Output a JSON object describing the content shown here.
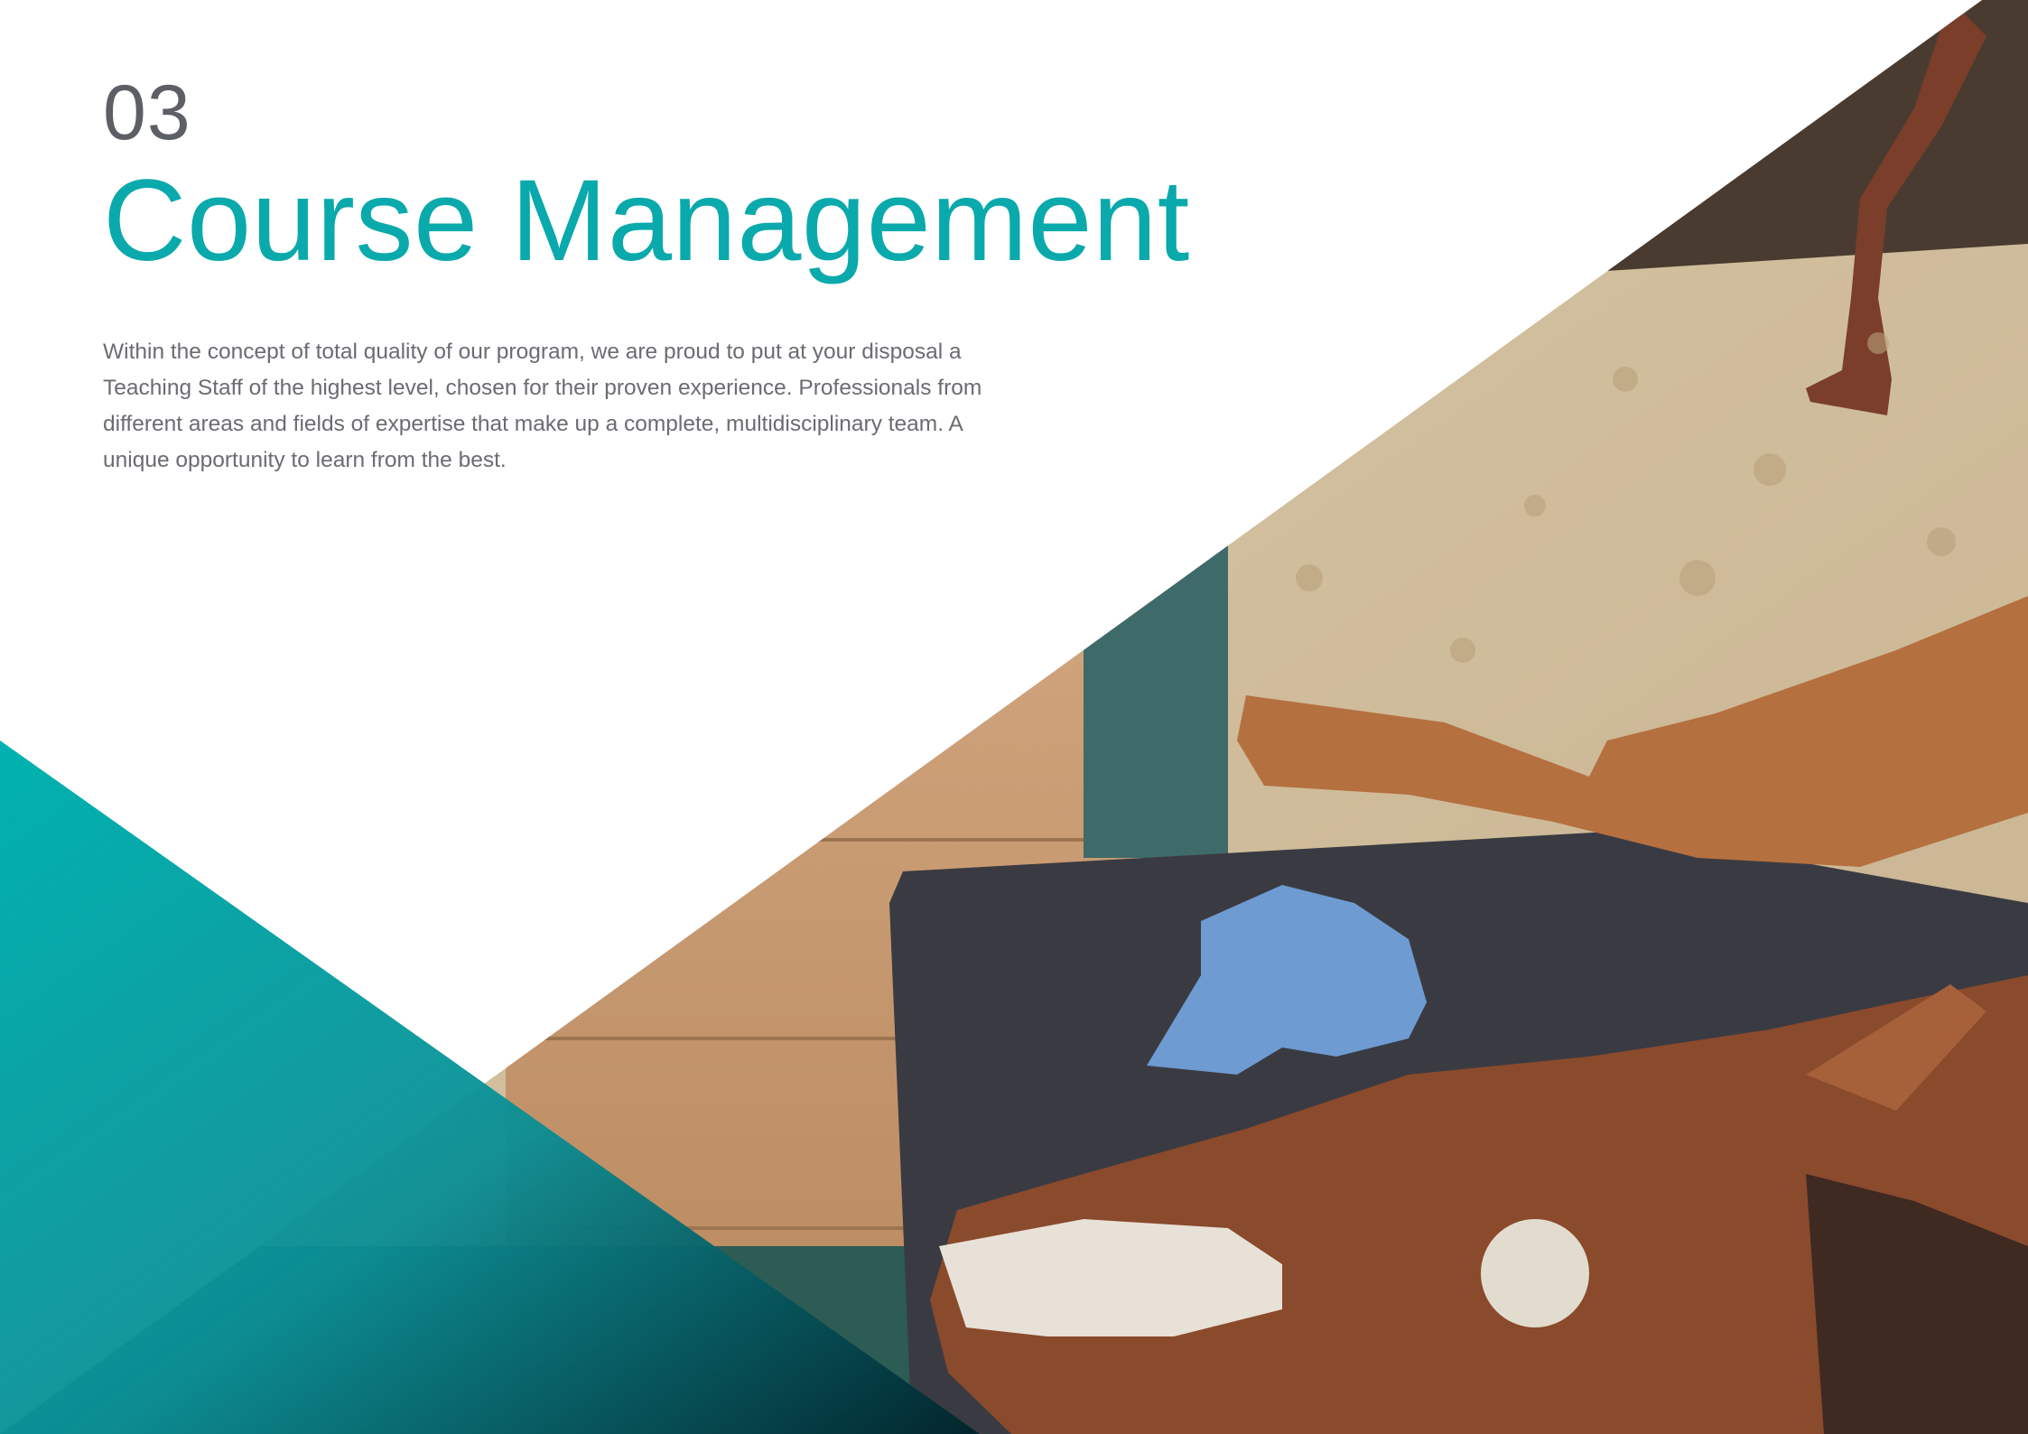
{
  "section": {
    "number": "03",
    "title": "Course Management",
    "body": "Within the concept of total quality of our program, we are proud to put at your disposal a Teaching Staff of the highest level, chosen for their proven experience. Professionals from different areas and fields of expertise that make up a complete, multidisciplinary team. A unique opportunity to learn from the best."
  },
  "colors": {
    "accent": "#0aa9ac",
    "number_gray": "#5d5f66",
    "body_gray": "#6a6c72"
  },
  "image": {
    "subject": "foal lying on a mat in a stable"
  }
}
